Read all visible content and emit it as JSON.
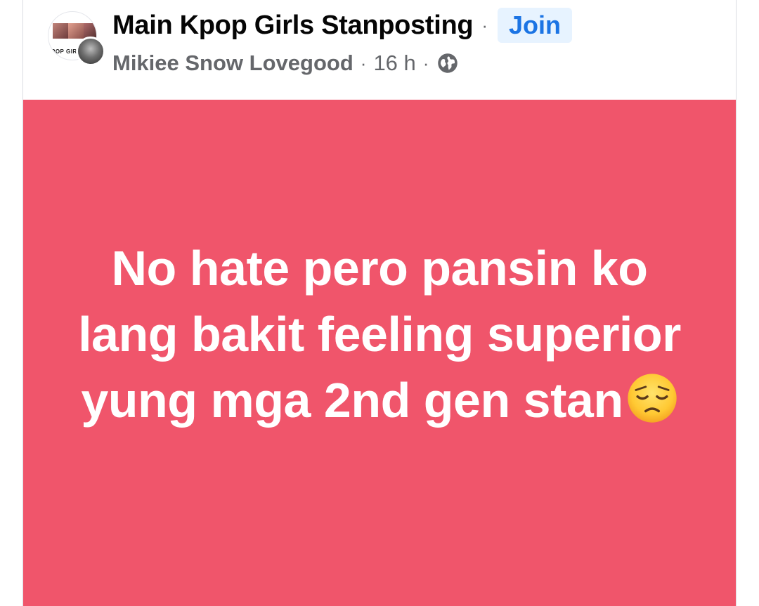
{
  "header": {
    "group_name": "Main Kpop Girls Stanposting",
    "separator": "·",
    "join_label": "Join",
    "group_avatar_text": "POP GIRL",
    "author": "Mikiee Snow Lovegood",
    "time": "16 h",
    "audience_icon": "globe-icon"
  },
  "post": {
    "text": "No hate pero pansin ko lang bakit feeling superior yung mga 2nd gen stan",
    "emoji_icon": "pensive-face-emoji",
    "background_color": "#f0556b",
    "text_color": "#ffffff"
  },
  "colors": {
    "join_bg": "#e7f3ff",
    "join_text": "#1b74e4",
    "meta_gray": "#65676b"
  }
}
